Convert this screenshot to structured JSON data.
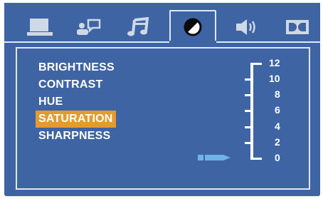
{
  "tabs": [
    {
      "icon": "laptop-icon",
      "active": false
    },
    {
      "icon": "speech-person-icon",
      "active": false
    },
    {
      "icon": "music-note-icon",
      "active": false
    },
    {
      "icon": "contrast-circle-icon",
      "active": true
    },
    {
      "icon": "speaker-icon",
      "active": false
    },
    {
      "icon": "dolby-icon",
      "active": false
    }
  ],
  "menu": {
    "items": [
      "BRIGHTNESS",
      "CONTRAST",
      "HUE",
      "SATURATION",
      "SHARPNESS"
    ],
    "selected_index": 3
  },
  "scale": {
    "labels": [
      "12",
      "10",
      "8",
      "6",
      "4",
      "2",
      "0"
    ],
    "current_value": "0"
  },
  "colors": {
    "background": "#3e64a3",
    "border": "#dfe8f3",
    "highlight": "#e39b2d",
    "pointer": "#6fb3e8",
    "icon": "#cfd8e6"
  }
}
